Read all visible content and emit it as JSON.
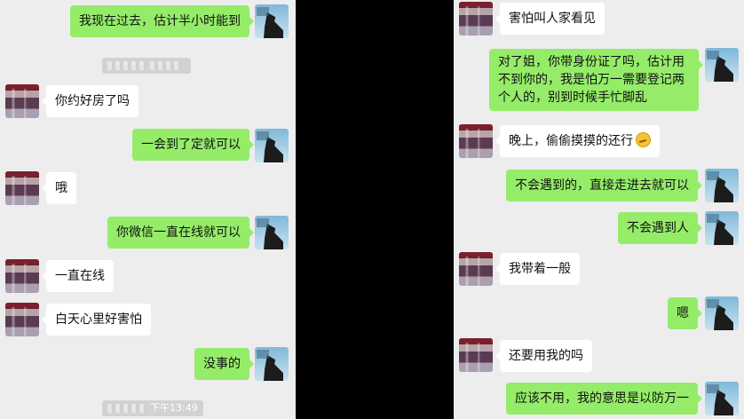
{
  "left": {
    "messages": [
      {
        "text": "我现在过去，估计半小时能到"
      },
      {
        "text": "你约好房了吗"
      },
      {
        "text": "一会到了定就可以"
      },
      {
        "text": "哦"
      },
      {
        "text": "你微信一直在线就可以"
      },
      {
        "text": "一直在线"
      },
      {
        "text": "白天心里好害怕"
      },
      {
        "text": "没事的"
      }
    ],
    "timestamp_bottom": "下午13:49"
  },
  "right": {
    "messages": [
      {
        "text": "害怕叫人家看见"
      },
      {
        "line1": "对了姐，你带身份证了吗，估计用",
        "line2": "不到你的，我是怕万一需要登记两",
        "line3": "个人的，别到时候手忙脚乱"
      },
      {
        "text": "晚上，偷偷摸摸的还行"
      },
      {
        "text": "不会遇到的，直接走进去就可以"
      },
      {
        "text": "不会遇到人"
      },
      {
        "text": "我带着一般"
      },
      {
        "text": "嗯"
      },
      {
        "text": "还要用我的吗"
      },
      {
        "text": "应该不用，我的意思是以防万一"
      }
    ]
  },
  "icons": {
    "emoji": "grimace-emoji-icon"
  },
  "colors": {
    "self_bubble": "#95ec69",
    "peer_bubble": "#ffffff",
    "chat_background": "#ededed",
    "divider": "#000000"
  }
}
